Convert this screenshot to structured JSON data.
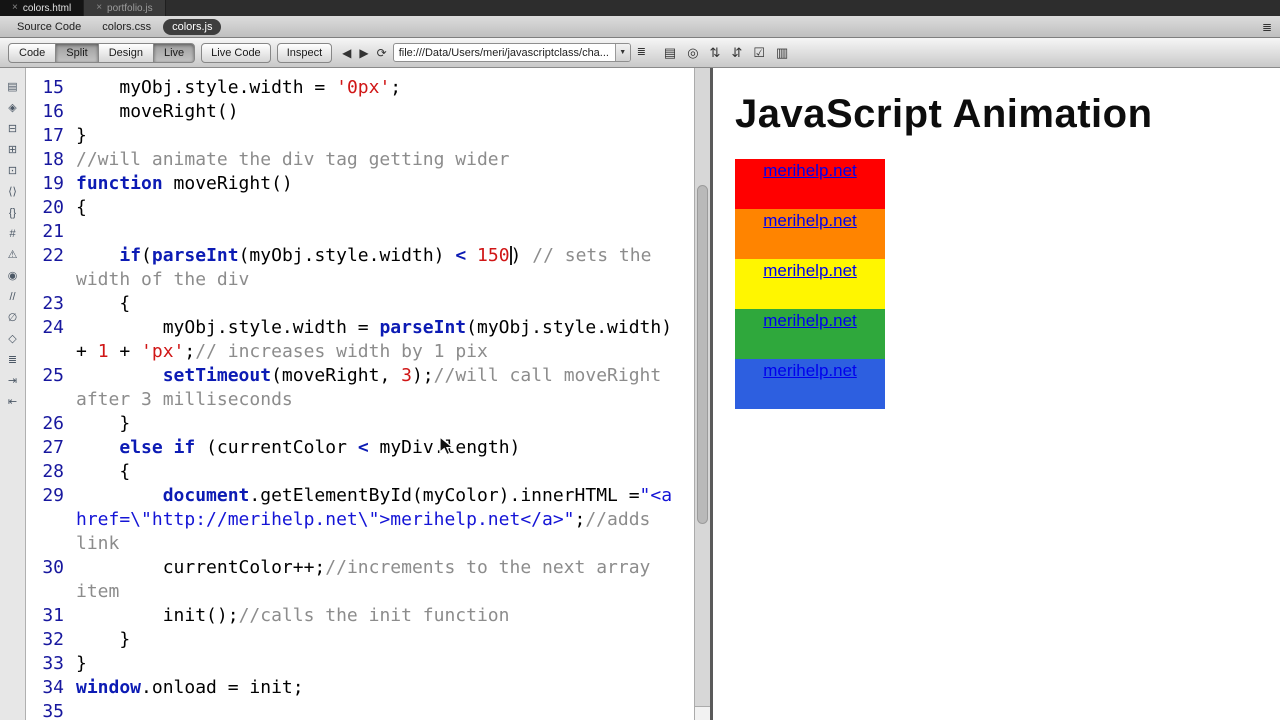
{
  "window": {
    "document_tabs": [
      {
        "label": "colors.html",
        "close": "×",
        "active": true
      },
      {
        "label": "portfolio.js",
        "close": "×",
        "active": false
      }
    ],
    "related_files": {
      "items": [
        {
          "label": "Source Code",
          "active": false
        },
        {
          "label": "colors.css",
          "active": false
        },
        {
          "label": "colors.js",
          "active": true
        }
      ],
      "menu_icon": "≣"
    },
    "toolbar": {
      "view_buttons": [
        {
          "label": "Code",
          "pressed": false
        },
        {
          "label": "Split",
          "pressed": true
        },
        {
          "label": "Design",
          "pressed": false
        },
        {
          "label": "Live",
          "pressed": true
        }
      ],
      "live_code_label": "Live Code",
      "inspect_label": "Inspect",
      "nav_icons": [
        {
          "name": "back-icon",
          "glyph": "◀"
        },
        {
          "name": "forward-icon",
          "glyph": "▶"
        },
        {
          "name": "refresh-icon",
          "glyph": "⟳"
        }
      ],
      "address": "file:///Data/Users/meri/javascriptclass/cha...",
      "address_dropdown_glyph": "▼",
      "code_navigator_glyph": "≣",
      "action_icons": [
        {
          "name": "file-management-icon",
          "glyph": "▤"
        },
        {
          "name": "preview-in-browser-icon",
          "glyph": "◎"
        },
        {
          "name": "get-put-files-icon",
          "glyph": "⇅"
        },
        {
          "name": "check-in-out-icon",
          "glyph": "⇵"
        },
        {
          "name": "validate-markup-icon",
          "glyph": "☑"
        },
        {
          "name": "compare-files-icon",
          "glyph": "▥"
        }
      ]
    }
  },
  "coding_toolbar": {
    "icons": [
      {
        "name": "open-documents-icon",
        "glyph": "▤"
      },
      {
        "name": "show-code-navigator-icon",
        "glyph": "◈"
      },
      {
        "name": "collapse-full-tag-icon",
        "glyph": "⊟"
      },
      {
        "name": "collapse-selection-icon",
        "glyph": "⊞"
      },
      {
        "name": "expand-all-icon",
        "glyph": "⊡"
      },
      {
        "name": "select-parent-tag-icon",
        "glyph": "⟨⟩"
      },
      {
        "name": "balance-braces-icon",
        "glyph": "{}"
      },
      {
        "name": "line-numbers-icon",
        "glyph": "#"
      },
      {
        "name": "highlight-invalid-code-icon",
        "glyph": "⚠"
      },
      {
        "name": "syntax-error-alerts-icon",
        "glyph": "◉"
      },
      {
        "name": "apply-comment-icon",
        "glyph": "//"
      },
      {
        "name": "remove-comment-icon",
        "glyph": "∅"
      },
      {
        "name": "wrap-tag-icon",
        "glyph": "◇"
      },
      {
        "name": "recent-snippets-icon",
        "glyph": "≣"
      },
      {
        "name": "indent-code-icon",
        "glyph": "⇥"
      },
      {
        "name": "outdent-code-icon",
        "glyph": "⇤"
      }
    ]
  },
  "code_editor": {
    "token_colors": {
      "pl": "#000000",
      "kw": "#0c1bb4",
      "st": "#d01616",
      "nu": "#d01616",
      "co": "#8c8c8c",
      "hs": "#1414d6"
    },
    "lines": [
      {
        "num": "15",
        "segments": [
          {
            "c": "pl",
            "t": "    myObj.style.width = "
          },
          {
            "c": "st",
            "t": "'0px'"
          },
          {
            "c": "pl",
            "t": ";"
          }
        ]
      },
      {
        "num": "16",
        "segments": [
          {
            "c": "pl",
            "t": "    moveRight()"
          }
        ]
      },
      {
        "num": "17",
        "segments": [
          {
            "c": "pl",
            "t": "}"
          }
        ]
      },
      {
        "num": "18",
        "segments": [
          {
            "c": "co",
            "t": "//will animate the div tag getting wider"
          }
        ]
      },
      {
        "num": "19",
        "segments": [
          {
            "c": "kw",
            "t": "function"
          },
          {
            "c": "pl",
            "t": " moveRight()"
          }
        ]
      },
      {
        "num": "20",
        "segments": [
          {
            "c": "pl",
            "t": "{"
          }
        ]
      },
      {
        "num": "21",
        "segments": []
      },
      {
        "num": "22",
        "segments": [
          {
            "c": "pl",
            "t": "    "
          },
          {
            "c": "kw",
            "t": "if"
          },
          {
            "c": "pl",
            "t": "("
          },
          {
            "c": "kw",
            "t": "parseInt"
          },
          {
            "c": "pl",
            "t": "(myObj.style.width) "
          },
          {
            "c": "kw",
            "t": "<"
          },
          {
            "c": "pl",
            "t": " "
          },
          {
            "c": "nu",
            "t": "150"
          },
          {
            "c": "ca",
            "t": ""
          },
          {
            "c": "pl",
            "t": ") "
          },
          {
            "c": "co",
            "t": "// sets the width of the div"
          }
        ]
      },
      {
        "num": "23",
        "segments": [
          {
            "c": "pl",
            "t": "    {"
          }
        ]
      },
      {
        "num": "24",
        "segments": [
          {
            "c": "pl",
            "t": "        myObj.style.width = "
          },
          {
            "c": "kw",
            "t": "parseInt"
          },
          {
            "c": "pl",
            "t": "(myObj.style.width) + "
          },
          {
            "c": "nu",
            "t": "1"
          },
          {
            "c": "pl",
            "t": " + "
          },
          {
            "c": "st",
            "t": "'px'"
          },
          {
            "c": "pl",
            "t": ";"
          },
          {
            "c": "co",
            "t": "// increases width by 1 pix"
          }
        ]
      },
      {
        "num": "25",
        "segments": [
          {
            "c": "pl",
            "t": "        "
          },
          {
            "c": "kw",
            "t": "setTimeout"
          },
          {
            "c": "pl",
            "t": "(moveRight, "
          },
          {
            "c": "nu",
            "t": "3"
          },
          {
            "c": "pl",
            "t": ");"
          },
          {
            "c": "co",
            "t": "//will call moveRight after 3 milliseconds"
          }
        ]
      },
      {
        "num": "26",
        "segments": [
          {
            "c": "pl",
            "t": "    }"
          }
        ]
      },
      {
        "num": "27",
        "segments": [
          {
            "c": "pl",
            "t": "    "
          },
          {
            "c": "kw",
            "t": "else"
          },
          {
            "c": "pl",
            "t": " "
          },
          {
            "c": "kw",
            "t": "if"
          },
          {
            "c": "pl",
            "t": " (currentColor "
          },
          {
            "c": "kw",
            "t": "<"
          },
          {
            "c": "pl",
            "t": " myDiv.length)"
          }
        ]
      },
      {
        "num": "28",
        "segments": [
          {
            "c": "pl",
            "t": "    {"
          }
        ]
      },
      {
        "num": "29",
        "segments": [
          {
            "c": "pl",
            "t": "        "
          },
          {
            "c": "kw",
            "t": "document"
          },
          {
            "c": "pl",
            "t": ".getElementById(myColor).innerHTML ="
          },
          {
            "c": "hs",
            "t": "\"<a href=\\\"http://merihelp.net\\\">merihelp.net</a>\""
          },
          {
            "c": "pl",
            "t": ";"
          },
          {
            "c": "co",
            "t": "//adds link"
          }
        ]
      },
      {
        "num": "30",
        "segments": [
          {
            "c": "pl",
            "t": "        currentColor++;"
          },
          {
            "c": "co",
            "t": "//increments to the next array item"
          }
        ]
      },
      {
        "num": "31",
        "segments": [
          {
            "c": "pl",
            "t": "        init();"
          },
          {
            "c": "co",
            "t": "//calls the init function"
          }
        ]
      },
      {
        "num": "32",
        "segments": [
          {
            "c": "pl",
            "t": "    }"
          }
        ]
      },
      {
        "num": "33",
        "segments": [
          {
            "c": "pl",
            "t": "}"
          }
        ]
      },
      {
        "num": "34",
        "segments": [
          {
            "c": "kw",
            "t": "window"
          },
          {
            "c": "pl",
            "t": ".onload = init;"
          }
        ]
      },
      {
        "num": "35",
        "segments": []
      }
    ]
  },
  "preview": {
    "title": "JavaScript Animation",
    "link_color": "#0000ee",
    "boxes": [
      {
        "color": "#ff0000",
        "label": "merihelp.net"
      },
      {
        "color": "#ff8400",
        "label": "merihelp.net"
      },
      {
        "color": "#fff600",
        "label": "merihelp.net"
      },
      {
        "color": "#2fa83c",
        "label": "merihelp.net"
      },
      {
        "color": "#2d5fe0",
        "label": "merihelp.net"
      }
    ]
  }
}
